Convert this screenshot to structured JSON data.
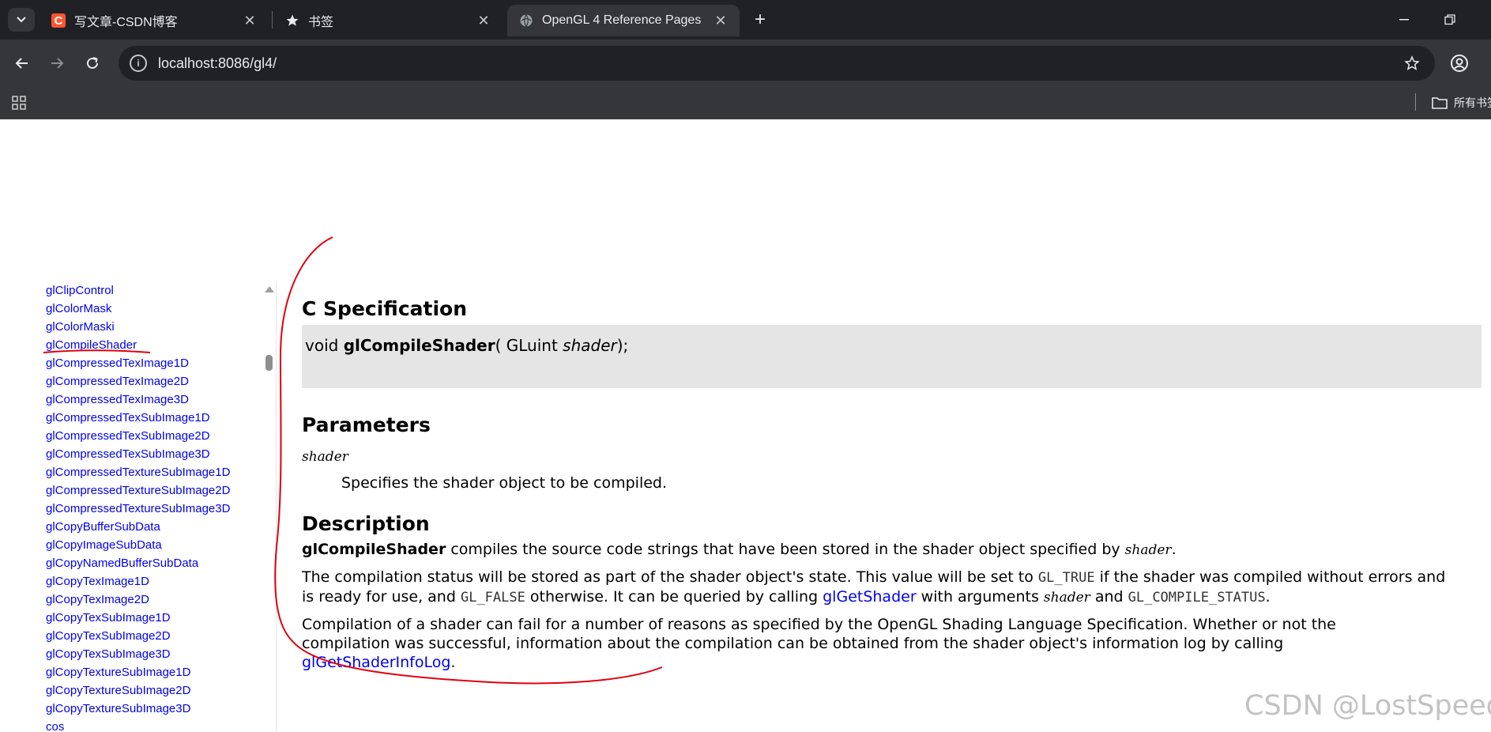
{
  "browser": {
    "tabs": [
      {
        "title": "写文章-CSDN博客",
        "icon": "csdn-icon",
        "active": false
      },
      {
        "title": "书签",
        "icon": "star-icon",
        "active": false
      },
      {
        "title": "OpenGL 4 Reference Pages",
        "icon": "globe-icon",
        "active": true
      }
    ],
    "url": "localhost:8086/gl4/",
    "bookmark_folder": "所有书签"
  },
  "sidebar": {
    "items": [
      "glClipControl",
      "glColorMask",
      "glColorMaski",
      "glCompileShader",
      "glCompressedTexImage1D",
      "glCompressedTexImage2D",
      "glCompressedTexImage3D",
      "glCompressedTexSubImage1D",
      "glCompressedTexSubImage2D",
      "glCompressedTexSubImage3D",
      "glCompressedTextureSubImage1D",
      "glCompressedTextureSubImage2D",
      "glCompressedTextureSubImage3D",
      "glCopyBufferSubData",
      "glCopyImageSubData",
      "glCopyNamedBufferSubData",
      "glCopyTexImage1D",
      "glCopyTexImage2D",
      "glCopyTexSubImage1D",
      "glCopyTexSubImage2D",
      "glCopyTexSubImage3D",
      "glCopyTextureSubImage1D",
      "glCopyTextureSubImage2D",
      "glCopyTextureSubImage3D",
      "cos"
    ]
  },
  "content": {
    "spec_heading": "C Specification",
    "synopsis": {
      "return_type": "void ",
      "func_name": "glCompileShader",
      "open": "( GLuint ",
      "param": "shader",
      "close": ")",
      "semicolon": ";"
    },
    "params_heading": "Parameters",
    "param_name": "shader",
    "param_desc": "Specifies the shader object to be compiled.",
    "desc_heading": "Description",
    "desc_p1": {
      "func": "glCompileShader",
      "text": " compiles the source code strings that have been stored in the shader object specified by ",
      "param": "shader",
      "end": "."
    },
    "desc_p2": {
      "t1": "The compilation status will be stored as part of the shader object's state. This value will be set to ",
      "c1": "GL_TRUE",
      "t2": " if the shader was compiled without errors and is ready for use, and ",
      "c2": "GL_FALSE",
      "t3": " otherwise. It can be queried by calling ",
      "link": "glGetShader",
      "t4": " with arguments ",
      "param": "shader",
      "t5": " and ",
      "c3": "GL_COMPILE_STATUS",
      "end": "."
    },
    "desc_p3": {
      "text": "Compilation of a shader can fail for a number of reasons as specified by the OpenGL Shading Language Specification. Whether or not the compilation was successful, information about the compilation can be obtained from the shader object's information log by calling ",
      "link": "glGetShaderInfoLog",
      "end": "."
    }
  },
  "watermark": "CSDN @LostSpeed",
  "colors": {
    "annotation": "#e0000f",
    "link": "#0000ee",
    "synopsis_bg": "#e5e5e5"
  }
}
